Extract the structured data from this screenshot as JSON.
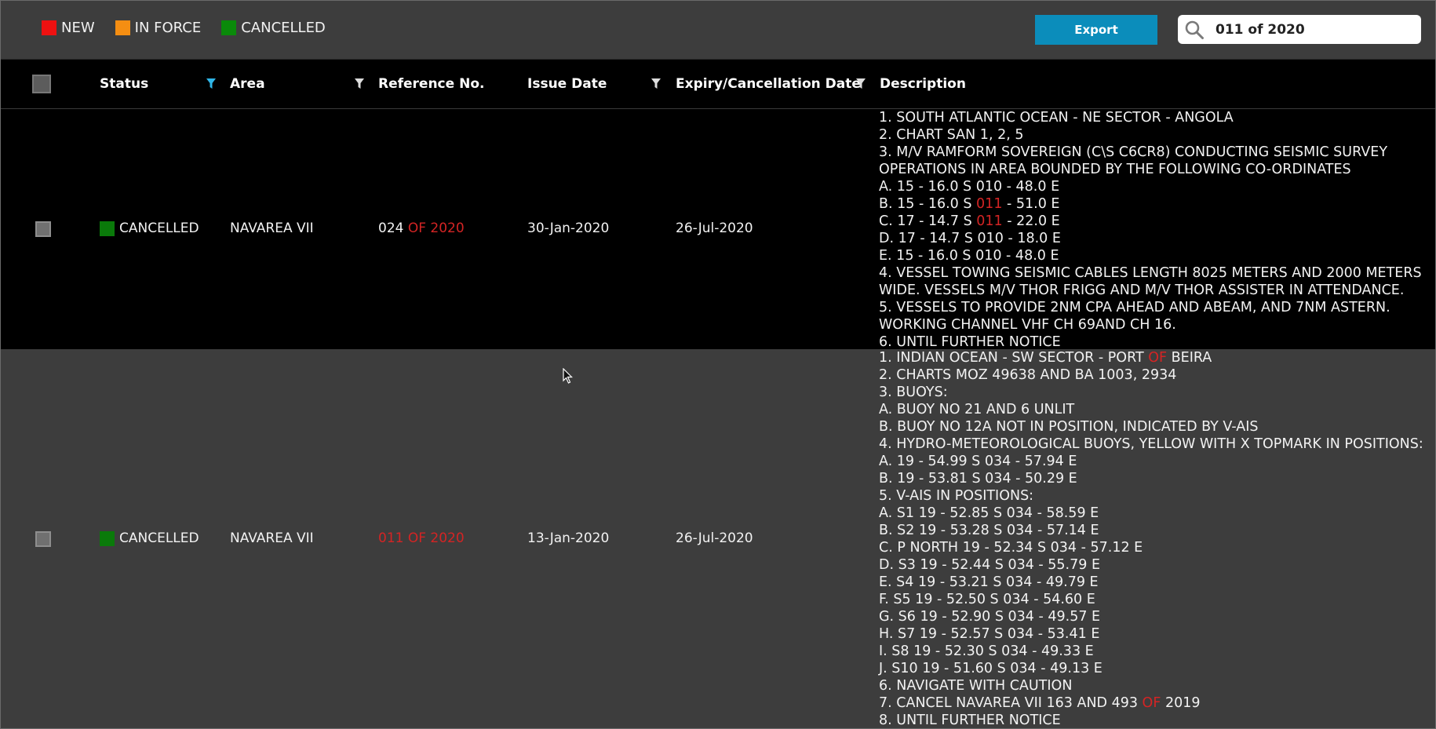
{
  "legend": [
    {
      "label": "NEW",
      "color": "#ee1111"
    },
    {
      "label": "IN FORCE",
      "color": "#f58e12"
    },
    {
      "label": "CANCELLED",
      "color": "#0a8a0a"
    }
  ],
  "toolbar": {
    "export_label": "Export"
  },
  "search": {
    "value": "011 of 2020",
    "icon": "search-icon"
  },
  "columns": {
    "status": "Status",
    "area": "Area",
    "reference": "Reference No.",
    "issue_date": "Issue Date",
    "expiry_date": "Expiry/Cancellation Date",
    "description": "Description"
  },
  "highlight_color": "#d42424",
  "rows": [
    {
      "status": "CANCELLED",
      "status_color": "#0a7a0a",
      "area": "NAVAREA VII",
      "reference_pre": "024 ",
      "reference_hl": "OF 2020",
      "issue_date": "30-Jan-2020",
      "expiry_date": "26-Jul-2020",
      "description": [
        [
          {
            "t": "1. SOUTH ATLANTIC OCEAN - NE SECTOR - ANGOLA"
          }
        ],
        [
          {
            "t": "2. CHART SAN 1, 2, 5"
          }
        ],
        [
          {
            "t": "3. M/V RAMFORM SOVEREIGN (C\\S C6CR8) CONDUCTING SEISMIC SURVEY"
          }
        ],
        [
          {
            "t": "OPERATIONS IN AREA BOUNDED BY THE FOLLOWING CO-ORDINATES"
          }
        ],
        [
          {
            "t": "A. 15 - 16.0 S 010 - 48.0 E"
          }
        ],
        [
          {
            "t": "B. 15 - 16.0 S "
          },
          {
            "t": "011",
            "h": true
          },
          {
            "t": " - 51.0 E"
          }
        ],
        [
          {
            "t": "C. 17 - 14.7 S "
          },
          {
            "t": "011",
            "h": true
          },
          {
            "t": " - 22.0 E"
          }
        ],
        [
          {
            "t": "D. 17 - 14.7 S 010 - 18.0 E"
          }
        ],
        [
          {
            "t": "E. 15 - 16.0 S 010 - 48.0 E"
          }
        ],
        [
          {
            "t": "4. VESSEL TOWING SEISMIC CABLES LENGTH 8025 METERS AND 2000 METERS"
          }
        ],
        [
          {
            "t": "WIDE. VESSELS M/V THOR FRIGG AND M/V THOR ASSISTER IN ATTENDANCE."
          }
        ],
        [
          {
            "t": "5. VESSELS TO PROVIDE 2NM CPA AHEAD AND ABEAM, AND 7NM ASTERN."
          }
        ],
        [
          {
            "t": "WORKING CHANNEL VHF CH 69AND CH 16."
          }
        ],
        [
          {
            "t": "6. UNTIL FURTHER NOTICE"
          }
        ]
      ]
    },
    {
      "status": "CANCELLED",
      "status_color": "#0a7a0a",
      "area": "NAVAREA VII",
      "reference_pre": "",
      "reference_hl": "011 OF 2020",
      "issue_date": "13-Jan-2020",
      "expiry_date": "26-Jul-2020",
      "description": [
        [
          {
            "t": "1. INDIAN OCEAN - SW SECTOR - PORT "
          },
          {
            "t": "OF",
            "h": true
          },
          {
            "t": " BEIRA"
          }
        ],
        [
          {
            "t": "2. CHARTS MOZ 49638 AND BA 1003, 2934"
          }
        ],
        [
          {
            "t": "3. BUOYS:"
          }
        ],
        [
          {
            "t": "A. BUOY NO 21 AND 6 UNLIT"
          }
        ],
        [
          {
            "t": "B. BUOY NO 12A NOT IN POSITION, INDICATED BY V-AIS"
          }
        ],
        [
          {
            "t": "4. HYDRO-METEOROLOGICAL BUOYS, YELLOW WITH X TOPMARK IN POSITIONS:"
          }
        ],
        [
          {
            "t": "A. 19 - 54.99 S 034 - 57.94 E"
          }
        ],
        [
          {
            "t": "B. 19 - 53.81 S 034 - 50.29 E"
          }
        ],
        [
          {
            "t": "5. V-AIS IN POSITIONS:"
          }
        ],
        [
          {
            "t": "A. S1 19 - 52.85 S 034 - 58.59 E"
          }
        ],
        [
          {
            "t": "B. S2 19 - 53.28 S 034 - 57.14 E"
          }
        ],
        [
          {
            "t": "C. P NORTH 19 - 52.34 S 034 - 57.12 E"
          }
        ],
        [
          {
            "t": "D. S3 19 - 52.44 S 034 - 55.79 E"
          }
        ],
        [
          {
            "t": "E. S4 19 - 53.21 S 034 - 49.79 E"
          }
        ],
        [
          {
            "t": "F. S5 19 - 52.50 S 034 - 54.60 E"
          }
        ],
        [
          {
            "t": "G. S6 19 - 52.90 S 034 - 49.57 E"
          }
        ],
        [
          {
            "t": "H. S7 19 - 52.57 S 034 - 53.41 E"
          }
        ],
        [
          {
            "t": "I. S8 19 - 52.30 S 034 - 49.33 E"
          }
        ],
        [
          {
            "t": "J. S10 19 - 51.60 S 034 - 49.13 E"
          }
        ],
        [
          {
            "t": "6. NAVIGATE WITH CAUTION"
          }
        ],
        [
          {
            "t": "7. CANCEL NAVAREA VII 163 AND 493 "
          },
          {
            "t": "OF",
            "h": true
          },
          {
            "t": " 2019"
          }
        ],
        [
          {
            "t": "8. UNTIL FURTHER NOTICE"
          }
        ]
      ]
    }
  ]
}
